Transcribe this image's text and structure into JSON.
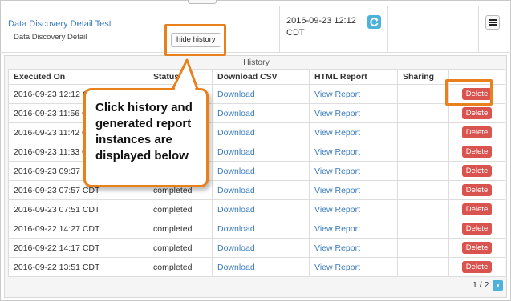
{
  "report": {
    "title": "Data Discovery Detail Test",
    "subtitle": "Data Discovery Detail",
    "hide_history_label": "hide history",
    "date_line1": "2016-09-23 12:12",
    "date_line2": "CDT"
  },
  "history": {
    "title": "History",
    "columns": [
      "Executed On",
      "Status",
      "Download CSV",
      "HTML Report",
      "Sharing",
      ""
    ],
    "rows": [
      {
        "executed": "2016-09-23 12:12 CDT",
        "status": "",
        "download": "Download",
        "report": "View Report",
        "sharing": "",
        "delete": "Delete"
      },
      {
        "executed": "2016-09-23 11:56 CDT",
        "status": "",
        "download": "Download",
        "report": "View Report",
        "sharing": "",
        "delete": "Delete"
      },
      {
        "executed": "2016-09-23 11:42 CDT",
        "status": "",
        "download": "Download",
        "report": "View Report",
        "sharing": "",
        "delete": "Delete"
      },
      {
        "executed": "2016-09-23 11:33 CDT",
        "status": "",
        "download": "Download",
        "report": "View Report",
        "sharing": "",
        "delete": "Delete"
      },
      {
        "executed": "2016-09-23 09:37 CDT",
        "status": "",
        "download": "Download",
        "report": "View Report",
        "sharing": "",
        "delete": "Delete"
      },
      {
        "executed": "2016-09-23 07:57 CDT",
        "status": "completed",
        "download": "Download",
        "report": "View Report",
        "sharing": "",
        "delete": "Delete"
      },
      {
        "executed": "2016-09-23 07:51 CDT",
        "status": "completed",
        "download": "Download",
        "report": "View Report",
        "sharing": "",
        "delete": "Delete"
      },
      {
        "executed": "2016-09-22 14:27 CDT",
        "status": "completed",
        "download": "Download",
        "report": "View Report",
        "sharing": "",
        "delete": "Delete"
      },
      {
        "executed": "2016-09-22 14:17 CDT",
        "status": "completed",
        "download": "Download",
        "report": "View Report",
        "sharing": "",
        "delete": "Delete"
      },
      {
        "executed": "2016-09-22 13:51 CDT",
        "status": "completed",
        "download": "Download",
        "report": "View Report",
        "sharing": "",
        "delete": "Delete"
      }
    ],
    "pagination": "1 / 2"
  },
  "annotation": {
    "callout_text": "Click history and generated report instances are displayed below",
    "highlight_color": "#e8801c"
  },
  "icons": {
    "refresh": "refresh-icon",
    "menu": "menu-icon",
    "next_page": "next-page-icon"
  },
  "colors": {
    "link": "#3a7bbf",
    "delete_button": "#d9534f",
    "accent": "#4fb3d9"
  }
}
